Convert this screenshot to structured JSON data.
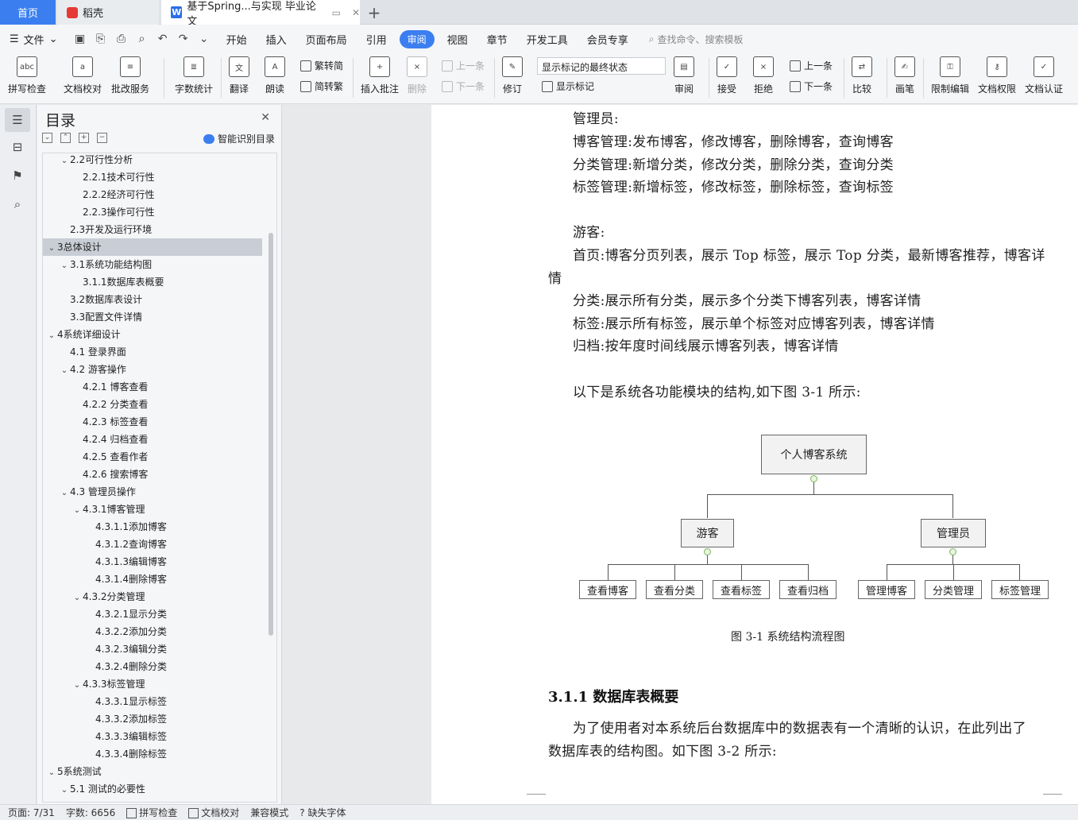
{
  "tabs": {
    "home": "首页",
    "daoke": "稻壳",
    "doc": "基于Spring...与实现 毕业论文",
    "add": "+"
  },
  "menu": {
    "file": "文件",
    "items": [
      "开始",
      "插入",
      "页面布局",
      "引用",
      "审阅",
      "视图",
      "章节",
      "开发工具",
      "会员专享"
    ],
    "active": "审阅",
    "search": "查找命令、搜索模板"
  },
  "ribbon": {
    "spell": "拼写检查",
    "proof": "文档校对",
    "batch": "批改服务",
    "wordcount": "字数统计",
    "translate": "翻译",
    "read": "朗读",
    "t2s": "繁转简",
    "s2t": "简转繁",
    "insert_comment": "插入批注",
    "delete": "删除",
    "prev_comment": "上一条",
    "next_comment": "下一条",
    "revise": "修订",
    "markup_state": "显示标记的最终状态",
    "show_markup": "显示标记",
    "review": "审阅",
    "accept": "接受",
    "reject": "拒绝",
    "prev": "上一条",
    "next": "下一条",
    "compare": "比较",
    "pen": "画笔",
    "restrict": "限制编辑",
    "permission": "文档权限",
    "certify": "文档认证"
  },
  "toc": {
    "title": "目录",
    "smart": "智能识别目录",
    "items": [
      {
        "t": "2.2可行性分析",
        "l": 2,
        "c": true
      },
      {
        "t": "2.2.1技术可行性",
        "l": 3,
        "c": false
      },
      {
        "t": "2.2.2经济可行性",
        "l": 3,
        "c": false
      },
      {
        "t": "2.2.3操作可行性",
        "l": 3,
        "c": false
      },
      {
        "t": "2.3开发及运行环境",
        "l": 2,
        "c": false
      },
      {
        "t": "3总体设计",
        "l": 1,
        "c": true,
        "s": true
      },
      {
        "t": "3.1系统功能结构图",
        "l": 2,
        "c": true
      },
      {
        "t": "3.1.1数据库表概要",
        "l": 3,
        "c": false
      },
      {
        "t": "3.2数据库表设计",
        "l": 2,
        "c": false
      },
      {
        "t": "3.3配置文件详情",
        "l": 2,
        "c": false
      },
      {
        "t": "4系统详细设计",
        "l": 1,
        "c": true
      },
      {
        "t": "4.1 登录界面",
        "l": 2,
        "c": false
      },
      {
        "t": "4.2 游客操作",
        "l": 2,
        "c": true
      },
      {
        "t": "4.2.1 博客查看",
        "l": 3,
        "c": false
      },
      {
        "t": "4.2.2 分类查看",
        "l": 3,
        "c": false
      },
      {
        "t": "4.2.3 标签查看",
        "l": 3,
        "c": false
      },
      {
        "t": "4.2.4 归档查看",
        "l": 3,
        "c": false
      },
      {
        "t": "4.2.5 查看作者",
        "l": 3,
        "c": false
      },
      {
        "t": "4.2.6 搜索博客",
        "l": 3,
        "c": false
      },
      {
        "t": "4.3 管理员操作",
        "l": 2,
        "c": true
      },
      {
        "t": "4.3.1博客管理",
        "l": 3,
        "c": true
      },
      {
        "t": "4.3.1.1添加博客",
        "l": 4,
        "c": false
      },
      {
        "t": "4.3.1.2查询博客",
        "l": 4,
        "c": false
      },
      {
        "t": "4.3.1.3编辑博客",
        "l": 4,
        "c": false
      },
      {
        "t": "4.3.1.4删除博客",
        "l": 4,
        "c": false
      },
      {
        "t": "4.3.2分类管理",
        "l": 3,
        "c": true
      },
      {
        "t": "4.3.2.1显示分类",
        "l": 4,
        "c": false
      },
      {
        "t": "4.3.2.2添加分类",
        "l": 4,
        "c": false
      },
      {
        "t": "4.3.2.3编辑分类",
        "l": 4,
        "c": false
      },
      {
        "t": "4.3.2.4删除分类",
        "l": 4,
        "c": false
      },
      {
        "t": "4.3.3标签管理",
        "l": 3,
        "c": true
      },
      {
        "t": "4.3.3.1显示标签",
        "l": 4,
        "c": false
      },
      {
        "t": "4.3.3.2添加标签",
        "l": 4,
        "c": false
      },
      {
        "t": "4.3.3.3编辑标签",
        "l": 4,
        "c": false
      },
      {
        "t": "4.3.3.4删除标签",
        "l": 4,
        "c": false
      },
      {
        "t": "5系统测试",
        "l": 1,
        "c": true
      },
      {
        "t": "5.1 测试的必要性",
        "l": 2,
        "c": true
      }
    ]
  },
  "doc": {
    "admin_title": "管理员:",
    "admin_lines": [
      "博客管理:发布博客，修改博客，删除博客，查询博客",
      "分类管理:新增分类，修改分类，删除分类，查询分类",
      "标签管理:新增标签，修改标签，删除标签，查询标签"
    ],
    "guest_title": "游客:",
    "guest_home": "首页:博客分页列表，展示 Top 标签，展示 Top 分类，最新博客推荐，博客详",
    "guest_home_cont": "情",
    "guest_lines": [
      "分类:展示所有分类，展示多个分类下博客列表，博客详情",
      "标签:展示所有标签，展示单个标签对应博客列表，博客详情",
      "归档:按年度时间线展示博客列表，博客详情"
    ],
    "intro": "以下是系统各功能模块的结构,如下图 3-1 所示:",
    "diagram": {
      "root": "个人博客系统",
      "guest": "游客",
      "admin": "管理员",
      "guest_leaves": [
        "查看博客",
        "查看分类",
        "查看标签",
        "查看归档"
      ],
      "admin_leaves": [
        "管理博客",
        "分类管理",
        "标签管理"
      ]
    },
    "caption": "图 3-1 系统结构流程图",
    "heading": "3.1.1  数据库表概要",
    "para1": "为了使用者对本系统后台数据库中的数据表有一个清晰的认识，在此列出了",
    "para2": "数据库表的结构图。如下图 3-2 所示:"
  },
  "status": {
    "page": "页面: 7/31",
    "words": "字数: 6656",
    "spell": "拼写检查",
    "proof": "文档校对",
    "compat": "兼容模式",
    "missing_font": "缺失字体"
  }
}
